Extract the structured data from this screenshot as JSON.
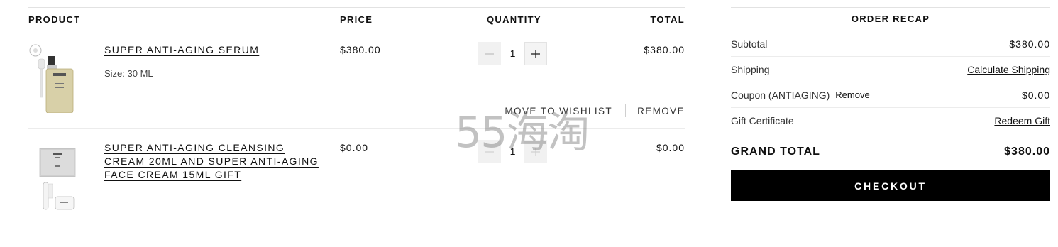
{
  "cart": {
    "headers": {
      "product": "PRODUCT",
      "price": "PRICE",
      "quantity": "QUANTITY",
      "total": "TOTAL"
    },
    "items": [
      {
        "name": "SUPER ANTI-AGING SERUM",
        "size": "Size: 30 ML",
        "price": "$380.00",
        "quantity": "1",
        "total": "$380.00",
        "move_to_wishlist": "MOVE TO WISHLIST",
        "remove": "REMOVE"
      },
      {
        "name": "SUPER ANTI-AGING CLEANSING CREAM 20ML AND SUPER ANTI-AGING FACE CREAM 15ML GIFT",
        "name_lines": [
          "SUPER ANTI-AGING CLEANSING",
          "CREAM 20ML AND SUPER ANTI-AGING",
          "FACE CREAM 15ML GIFT"
        ],
        "price": "$0.00",
        "quantity": "1",
        "total": "$0.00"
      }
    ]
  },
  "watermark": "55海淘",
  "recap": {
    "title": "ORDER RECAP",
    "subtotal_label": "Subtotal",
    "subtotal_value": "$380.00",
    "shipping_label": "Shipping",
    "shipping_link": "Calculate Shipping",
    "coupon_label": "Coupon (ANTIAGING)",
    "coupon_remove": "Remove",
    "coupon_value": "$0.00",
    "gift_label": "Gift Certificate",
    "gift_link": "Redeem Gift",
    "grand_total_label": "GRAND TOTAL",
    "grand_total_value": "$380.00",
    "checkout_label": "CHECKOUT"
  }
}
